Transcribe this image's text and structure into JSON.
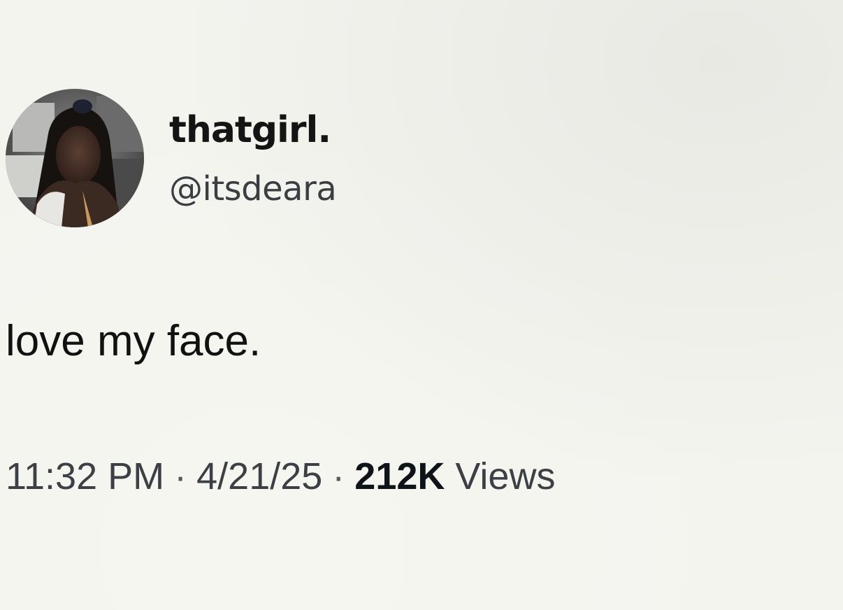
{
  "user": {
    "display_name": "thatgirl.",
    "handle": "@itsdeara"
  },
  "tweet": {
    "text": "love my face.",
    "time": "11:32 PM",
    "date": "4/21/25",
    "separator": "·",
    "views_count": "212K",
    "views_label": "Views"
  }
}
